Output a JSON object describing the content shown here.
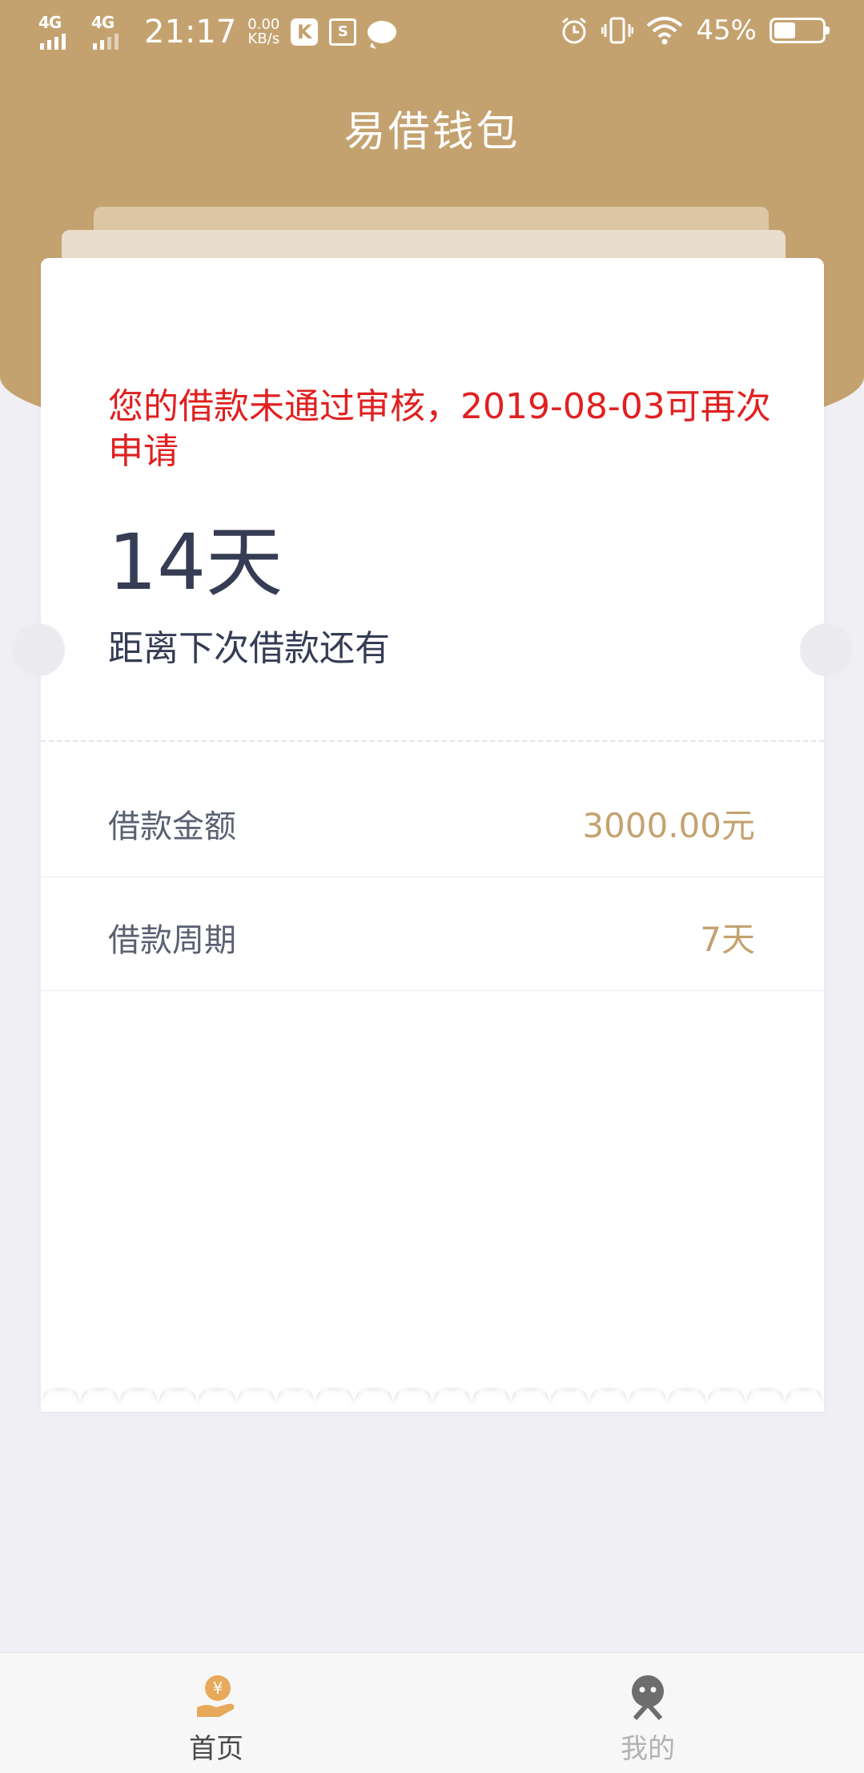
{
  "status_bar": {
    "network1": "4G",
    "network2": "4G",
    "time": "21:17",
    "speed_value": "0.00",
    "speed_unit": "KB/s",
    "app_icon_k": "K",
    "app_icon_s": "S",
    "battery_percent": "45%",
    "battery_level": 0.45,
    "icons": [
      "signal-icon",
      "k-app-icon",
      "s-app-icon",
      "message-icon",
      "alarm-icon",
      "vibrate-icon",
      "wifi-icon",
      "battery-icon"
    ]
  },
  "header": {
    "title": "易借钱包"
  },
  "card": {
    "notice": "您的借款未通过审核，2019-08-03可再次申请",
    "days_value": "14天",
    "days_caption": "距离下次借款还有",
    "rows": [
      {
        "label": "借款金额",
        "value": "3000.00元"
      },
      {
        "label": "借款周期",
        "value": "7天"
      }
    ]
  },
  "tabbar": {
    "tabs": [
      {
        "label": "首页",
        "icon": "loan-hand-icon",
        "active": true
      },
      {
        "label": "我的",
        "icon": "profile-icon",
        "active": false
      }
    ]
  },
  "colors": {
    "brand_gold": "#c4a270",
    "notice_red": "#e02020",
    "text_dark": "#353c54",
    "page_bg": "#f0f0f4"
  }
}
